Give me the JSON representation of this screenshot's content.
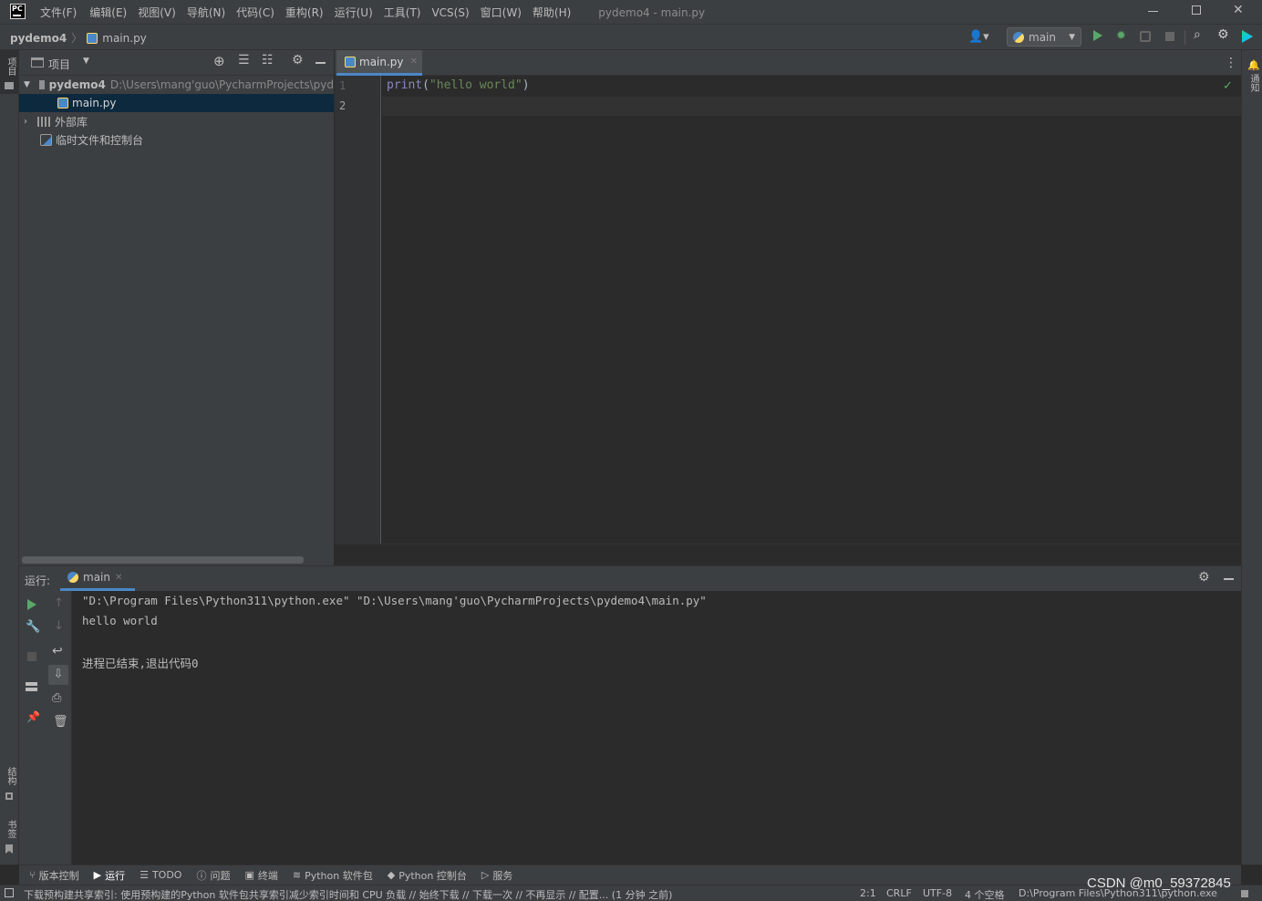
{
  "titlebar": {
    "menus": [
      "文件(F)",
      "编辑(E)",
      "视图(V)",
      "导航(N)",
      "代码(C)",
      "重构(R)",
      "运行(U)",
      "工具(T)",
      "VCS(S)",
      "窗口(W)",
      "帮助(H)"
    ],
    "title": "pydemo4 - main.py",
    "logo": "PC"
  },
  "navbar": {
    "project": "pydemo4",
    "file": "main.py",
    "run_config": "main"
  },
  "left_strip": {
    "project_label": "项目",
    "structure_label": "结构",
    "bookmarks_label": "书签"
  },
  "right_strip": {
    "notifications_label": "通知"
  },
  "project_panel": {
    "title": "项目",
    "root_name": "pydemo4",
    "root_path": "D:\\Users\\mang'guo\\PycharmProjects\\pyd",
    "file": "main.py",
    "external_libs": "外部库",
    "scratches": "临时文件和控制台"
  },
  "editor": {
    "tab": "main.py",
    "line_numbers": [
      "1",
      "2"
    ],
    "code": {
      "keyword": "print",
      "open": "(",
      "string": "\"hello world\"",
      "close": ")"
    }
  },
  "run_panel": {
    "label": "运行:",
    "tab": "main",
    "console": [
      "\"D:\\Program Files\\Python311\\python.exe\" \"D:\\Users\\mang'guo\\PycharmProjects\\pydemo4\\main.py\"",
      "hello world",
      "",
      "进程已结束,退出代码0"
    ]
  },
  "bottom_tools": [
    "版本控制",
    "运行",
    "TODO",
    "问题",
    "终端",
    "Python 软件包",
    "Python 控制台",
    "服务"
  ],
  "status": {
    "message": "下载预构建共享索引: 使用预构建的Python 软件包共享索引减少索引时间和 CPU 负载 // 始终下载 // 下载一次 // 不再显示 // 配置... (1 分钟 之前)",
    "position": "2:1",
    "line_sep": "CRLF",
    "encoding": "UTF-8",
    "indent": "4 个空格",
    "interpreter": "D:\\Program Files\\Python311\\python.exe"
  },
  "watermark": "CSDN @m0_59372845",
  "colors": {
    "accent": "#4a88c7",
    "run_green": "#59a869",
    "keyword": "#8888c6",
    "string": "#6a8759",
    "selection": "#0d293e"
  }
}
